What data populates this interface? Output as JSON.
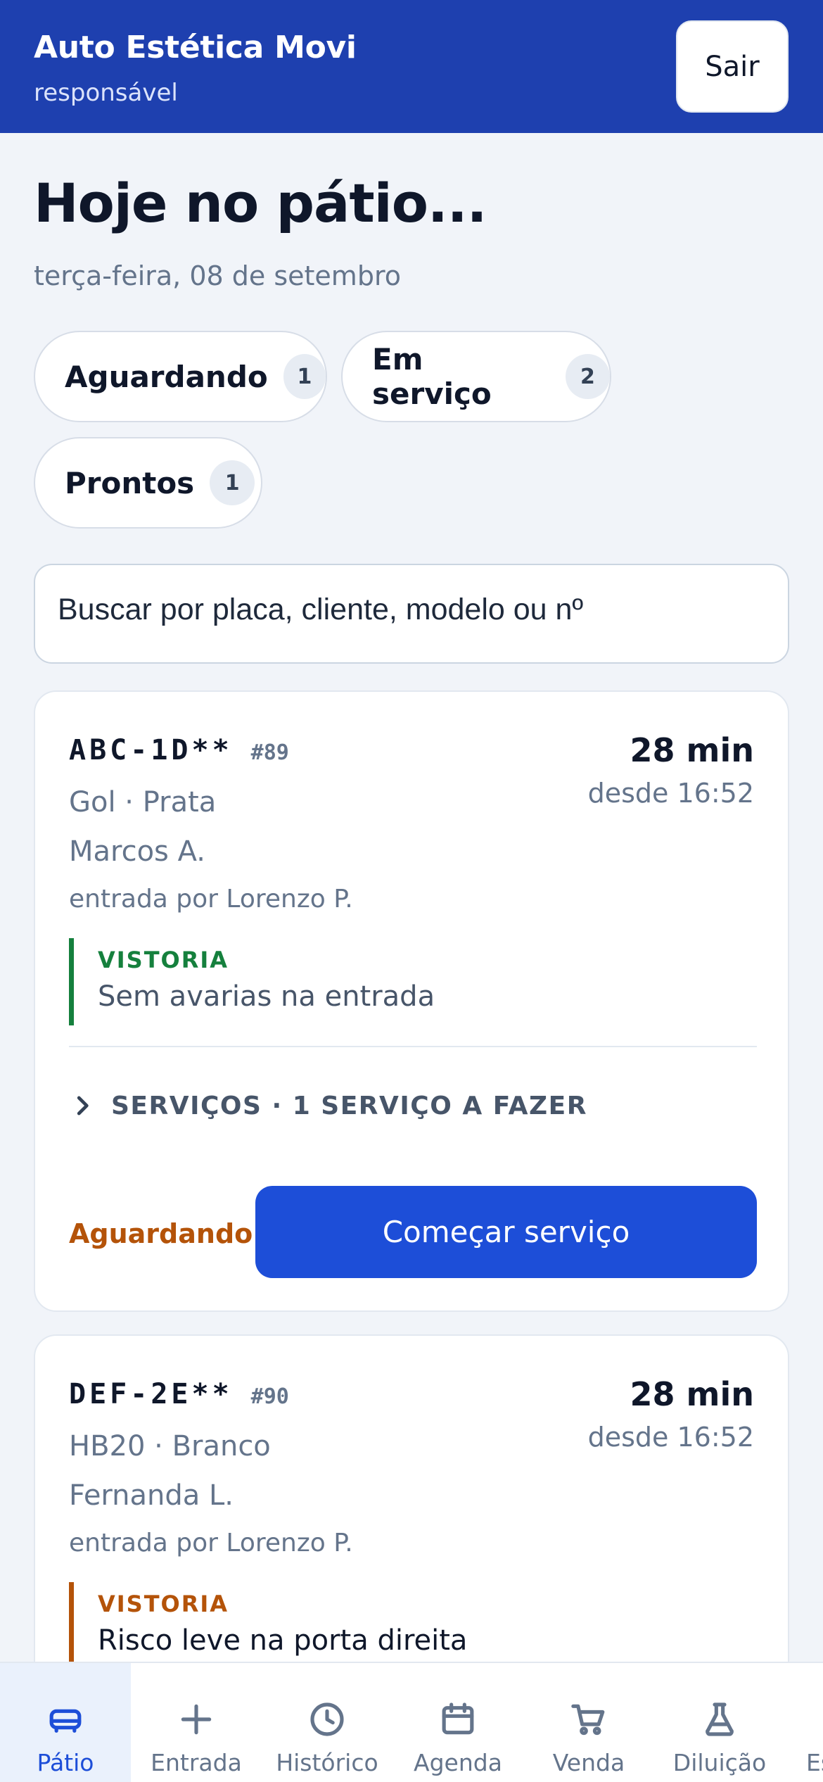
{
  "header": {
    "title": "Auto Estética Movi",
    "role": "responsável",
    "logout_label": "Sair"
  },
  "page": {
    "title": "Hoje no pátio...",
    "date": "terça-feira, 08 de setembro"
  },
  "filters": [
    {
      "label": "Aguardando",
      "count": "1"
    },
    {
      "label": "Em serviço",
      "count": "2"
    },
    {
      "label": "Prontos",
      "count": "1"
    }
  ],
  "search": {
    "placeholder": "Buscar por placa, cliente, modelo ou nº"
  },
  "cards": [
    {
      "plate": "ABC-1D**",
      "order": "#89",
      "elapsed": "28 min",
      "since": "desde 16:52",
      "vehicle": "Gol · Prata",
      "client": "Marcos A.",
      "entered_by": "entrada por Lorenzo P.",
      "inspection_label": "VISTORIA",
      "inspection_text": "Sem avarias na entrada",
      "services_label": "SERVIÇOS · 1 SERVIÇO A FAZER",
      "status": "Aguardando",
      "action_label": "Começar serviço"
    },
    {
      "plate": "DEF-2E**",
      "order": "#90",
      "elapsed": "28 min",
      "since": "desde 16:52",
      "vehicle": "HB20 · Branco",
      "client": "Fernanda L.",
      "entered_by": "entrada por Lorenzo P.",
      "inspection_label": "VISTORIA",
      "inspection_text": "Risco leve na porta direita"
    }
  ],
  "nav": [
    {
      "label": "Pátio",
      "icon": "car-icon",
      "active": true
    },
    {
      "label": "Entrada",
      "icon": "plus-icon"
    },
    {
      "label": "Histórico",
      "icon": "clock-icon"
    },
    {
      "label": "Agenda",
      "icon": "calendar-icon"
    },
    {
      "label": "Venda",
      "icon": "cart-icon"
    },
    {
      "label": "Diluição",
      "icon": "flask-icon"
    },
    {
      "label": "Es",
      "icon": "unknown-icon"
    }
  ],
  "colors": {
    "header_bg": "#1e40af",
    "primary": "#1d4ed8",
    "success": "#15803d",
    "warning": "#b45309",
    "page_bg": "#f1f4f9"
  }
}
